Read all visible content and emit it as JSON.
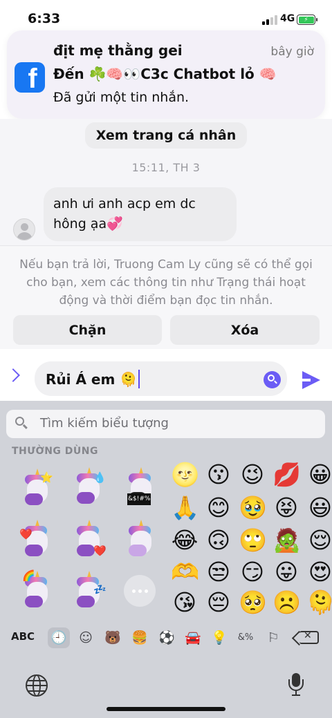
{
  "status_bar": {
    "time": "6:33",
    "network": "4G"
  },
  "notification": {
    "title": "địt mẹ thằng gei",
    "time": "bây giờ",
    "line2": "Đến ☘️🧠👀C3c Chatbot lỏ 🧠",
    "line3": "Đã gửi một tin nhắn."
  },
  "chat": {
    "profile_button": "Xem trang cá nhân",
    "timestamp": "15:11, TH 3",
    "message_line1": "anh ưi anh acp em dc",
    "message_line2": "hông ạa💞"
  },
  "request": {
    "info_text": "Nếu bạn trả lời, Truong Cam Ly cũng sẽ có thể gọi cho bạn, xem các thông tin như Trạng thái hoạt động và thời điểm bạn đọc tin nhắn.",
    "block_label": "Chặn",
    "delete_label": "Xóa"
  },
  "composer": {
    "value": "Rủi Á em 🫠"
  },
  "keyboard": {
    "search_placeholder": "Tìm kiếm biểu tượng",
    "section_title": "THƯỜNG DÙNG",
    "abc_label": "ABC",
    "sticker_effects": [
      "⭐",
      "💧",
      "&$!#%",
      "❤️",
      "❤️",
      "",
      "🌈",
      "💤"
    ],
    "emoji_grid": [
      [
        "🌝",
        "😗",
        "😉",
        "💋",
        "😀"
      ],
      [
        "🙏",
        "😊",
        "🥹",
        "😝",
        "😃"
      ],
      [
        "😂",
        "🙃",
        "🙄",
        "🧟",
        "😌"
      ],
      [
        "🫶",
        "😒",
        "😏",
        "😛",
        "😍"
      ],
      [
        "😘",
        "😔",
        "🥺",
        "☹️",
        "🫠"
      ]
    ],
    "categories": [
      "🕘",
      "☺",
      "🐻",
      "🍔",
      "⚽",
      "🚘",
      "💡",
      "&%",
      "⚐"
    ]
  },
  "colors": {
    "accent": "#6b5cf5",
    "facebook": "#1877f2"
  }
}
